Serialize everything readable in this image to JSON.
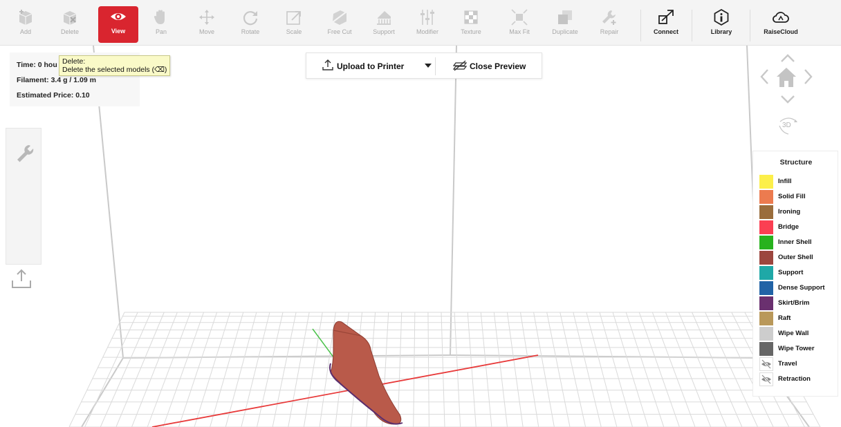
{
  "toolbar": {
    "tools": [
      {
        "id": "add",
        "label": "Add",
        "icon": "add-icon"
      },
      {
        "id": "delete",
        "label": "Delete",
        "icon": "delete-icon"
      },
      {
        "id": "view",
        "label": "View",
        "icon": "eye-icon",
        "active": true
      },
      {
        "id": "pan",
        "label": "Pan",
        "icon": "hand-icon"
      },
      {
        "id": "move",
        "label": "Move",
        "icon": "move-icon"
      },
      {
        "id": "rotate",
        "label": "Rotate",
        "icon": "rotate-icon"
      },
      {
        "id": "scale",
        "label": "Scale",
        "icon": "scale-icon"
      },
      {
        "id": "freecut",
        "label": "Free Cut",
        "icon": "free-cut-icon"
      },
      {
        "id": "support",
        "label": "Support",
        "icon": "support-icon"
      },
      {
        "id": "modifier",
        "label": "Modifier",
        "icon": "modifier-icon"
      },
      {
        "id": "texture",
        "label": "Texture",
        "icon": "texture-icon"
      },
      {
        "id": "maxfit",
        "label": "Max Fit",
        "icon": "max-fit-icon"
      },
      {
        "id": "duplicate",
        "label": "Duplicate",
        "icon": "duplicate-icon"
      },
      {
        "id": "repair",
        "label": "Repair",
        "icon": "repair-icon"
      },
      {
        "id": "connect",
        "label": "Connect",
        "icon": "connect-icon"
      },
      {
        "id": "library",
        "label": "Library",
        "icon": "library-icon"
      },
      {
        "id": "raisecloud",
        "label": "RaiseCloud",
        "icon": "cloud-icon"
      }
    ]
  },
  "info": {
    "time": "Time: 0 hou",
    "filament": "Filament: 3.4 g / 1.09 m",
    "price": "Estimated Price: 0.10"
  },
  "tooltip": {
    "title": "Delete:",
    "body": "Delete the selected models (⌫)"
  },
  "upload": {
    "upload_label": "Upload to Printer",
    "close_label": "Close Preview"
  },
  "nav": {
    "view3d_label": "3D"
  },
  "legend": {
    "title": "Structure",
    "items": [
      {
        "name": "Infill",
        "color": "#fcef4a"
      },
      {
        "name": "Solid Fill",
        "color": "#ec7b4f"
      },
      {
        "name": "Ironing",
        "color": "#9a6d3c"
      },
      {
        "name": "Bridge",
        "color": "#fb3f52"
      },
      {
        "name": "Inner Shell",
        "color": "#27b21e"
      },
      {
        "name": "Outer Shell",
        "color": "#9c463e"
      },
      {
        "name": "Support",
        "color": "#1fa8a7"
      },
      {
        "name": "Dense Support",
        "color": "#2163a6"
      },
      {
        "name": "Skirt/Brim",
        "color": "#6a306f"
      },
      {
        "name": "Raft",
        "color": "#b9985a"
      },
      {
        "name": "Wipe Wall",
        "color": "#cdcdcd"
      },
      {
        "name": "Wipe Tower",
        "color": "#666666"
      },
      {
        "name": "Travel",
        "color": "",
        "icon": "eye-slash-icon"
      },
      {
        "name": "Retraction",
        "color": "",
        "icon": "eye-slash-icon"
      }
    ]
  },
  "colors": {
    "accent": "#d9252f",
    "x_axis": "#e83a3a",
    "y_axis": "#4ac24a",
    "model": "#b95a4a",
    "model_outline": "#5a2e6f"
  }
}
